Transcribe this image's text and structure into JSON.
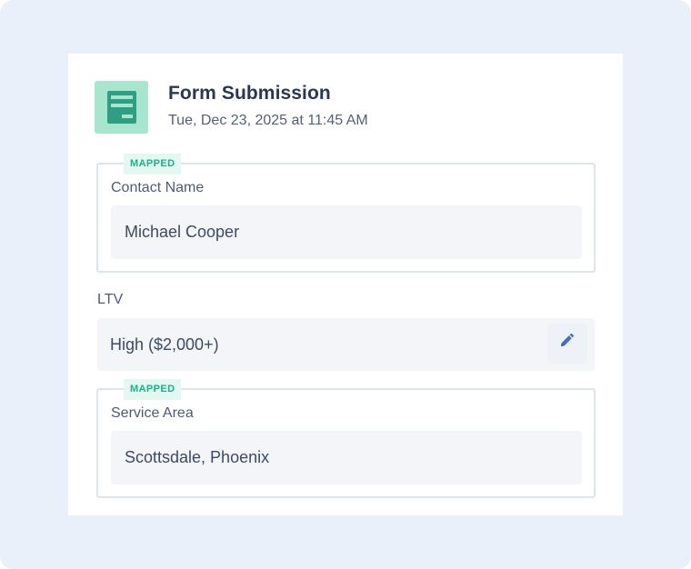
{
  "card": {
    "title": "Form Submission",
    "timestamp": "Tue, Dec 23, 2025 at 11:45 AM",
    "icon": "form-icon"
  },
  "fields": [
    {
      "badge": "MAPPED",
      "label": "Contact Name",
      "value": "Michael Cooper"
    },
    {
      "label": "LTV",
      "value": "High ($2,000+)",
      "action_icon": "pencil-icon"
    },
    {
      "badge": "MAPPED",
      "label": "Service Area",
      "value": "Scottsdale, Phoenix"
    }
  ],
  "colors": {
    "background": "#e9f0f9",
    "icon_bg": "#a6e6cf",
    "icon_fg": "#2f9e83",
    "badge_text": "#17b38a",
    "badge_bg": "#e4f7f0",
    "accent_blue": "#3f6fc4"
  }
}
